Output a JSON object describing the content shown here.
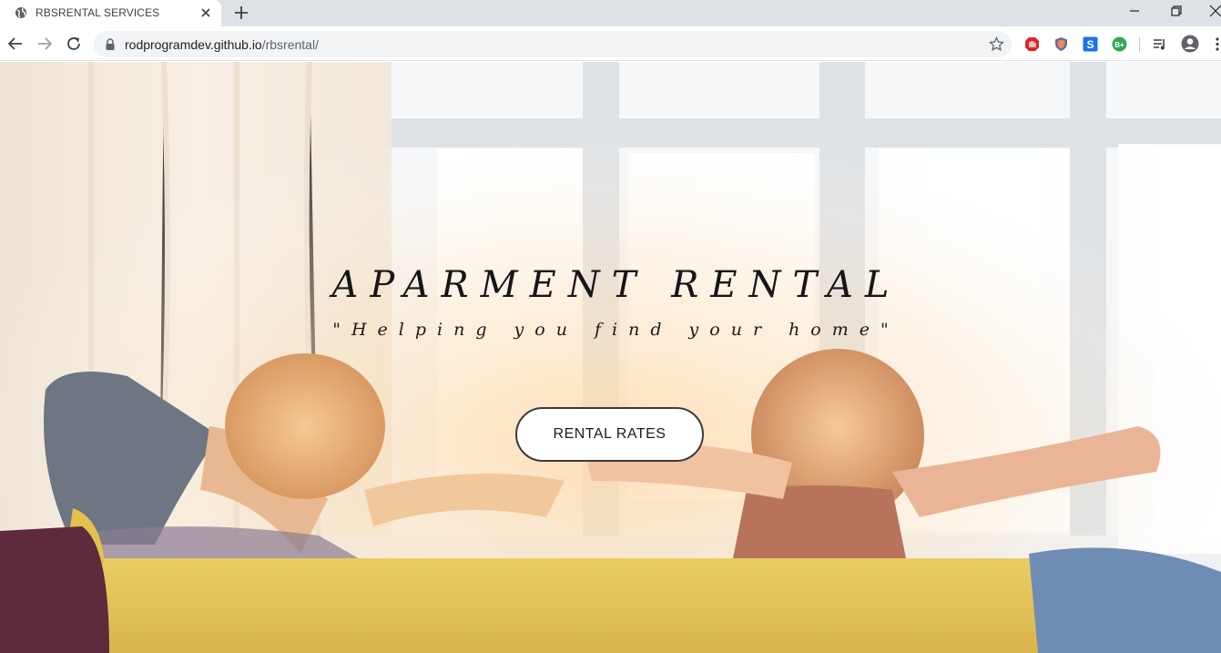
{
  "browser": {
    "tab_title": "RBSRENTAL SERVICES",
    "url_host": "rodprogramdev.github.io",
    "url_path": "/rbsrental/",
    "extension_icons": [
      "adblock-icon",
      "shield-extension-icon",
      "s-extension-icon",
      "b-plus-extension-icon"
    ]
  },
  "hero": {
    "title": "APARMENT RENTAL",
    "subtitle": "\"Helping you find your home\"",
    "cta_label": "RENTAL RATES"
  },
  "colors": {
    "accent_red": "#e02424",
    "extension_blue": "#1a73e8",
    "extension_green": "#34a853",
    "sofa_yellow": "#e3c24e"
  }
}
